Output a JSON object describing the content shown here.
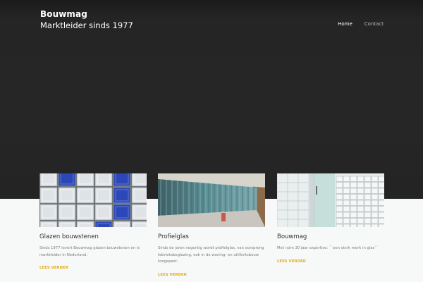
{
  "header": {
    "brand_name": "Bouwmag",
    "tagline": "Marktleider sinds 1977",
    "nav": [
      {
        "label": "Home",
        "active": true
      },
      {
        "label": "Contact",
        "active": false
      }
    ]
  },
  "colors": {
    "hero_background": "#262626",
    "accent": "#e6ad13",
    "page_background": "#f7f8f8"
  },
  "cards": [
    {
      "title": "Glazen bouwstenen",
      "text": "Sinds 1977 levert Bouwmag glazen bouwstenen en is marktleider in Nederland.",
      "link": "LEES VERDER"
    },
    {
      "title": "Profielglas",
      "text": "Sinds de jaren negentig wordt profielglas, van oorsprong fabrieksbeglazing, ook in de woning- en utiliteitsbouw toegepast.",
      "link": "LEES VERDER"
    },
    {
      "title": "Bouwmag",
      "text": "Met ruim 30 jaar expertise: ``een sterk merk in glas``",
      "link": "LEES VERDER"
    }
  ]
}
